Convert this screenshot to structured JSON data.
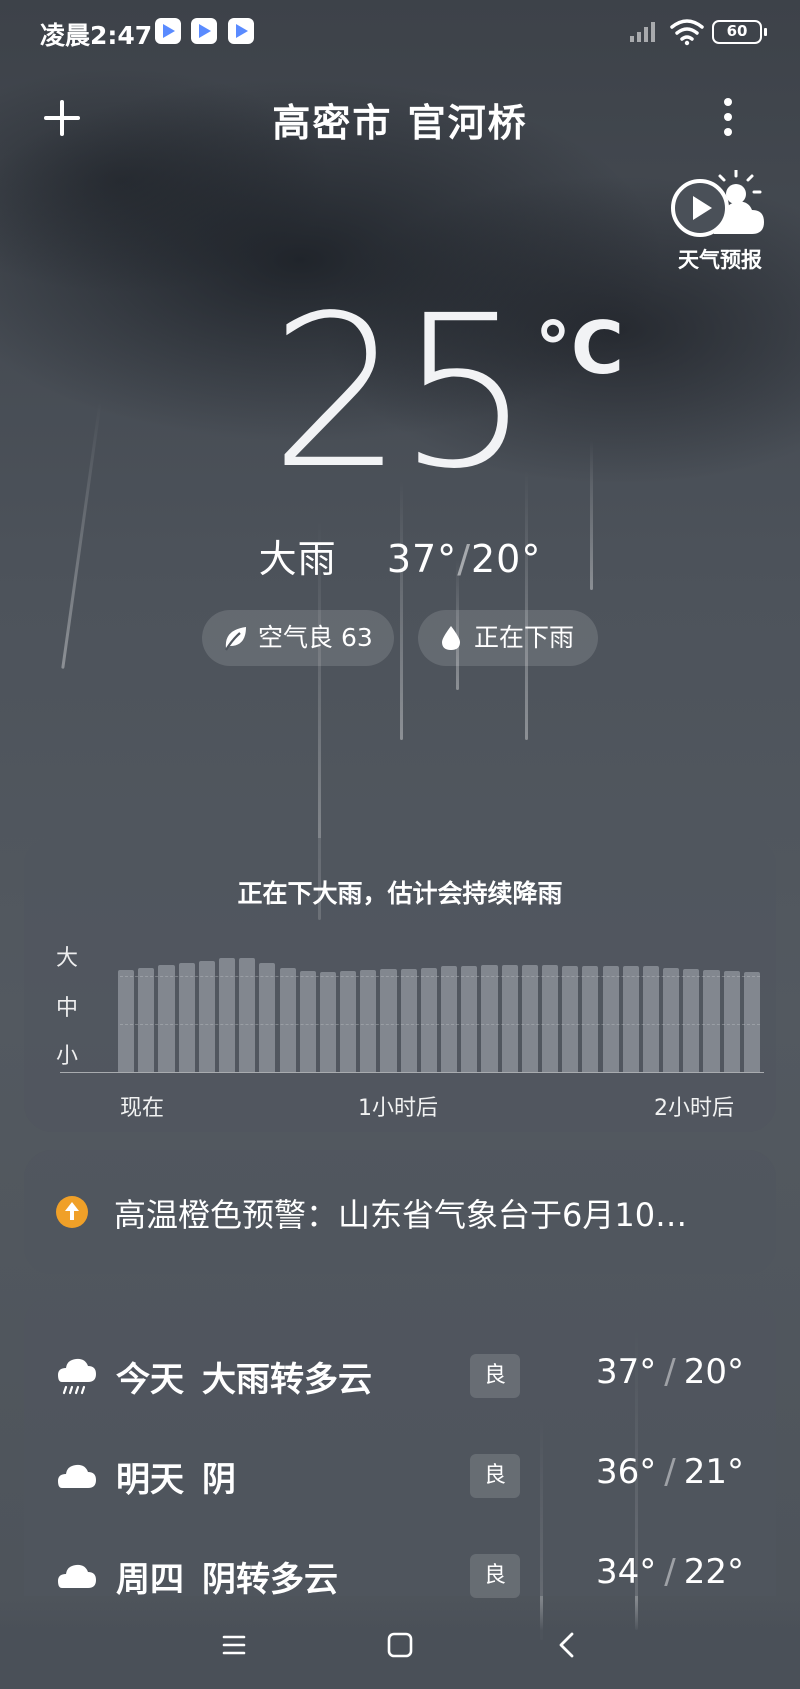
{
  "status_bar": {
    "time": "凌晨2:47",
    "battery": "60",
    "icons": [
      "app-store-icon",
      "app-store-icon",
      "app-store-icon",
      "signal-icon",
      "wifi-icon",
      "battery-icon"
    ]
  },
  "header": {
    "city": "高密市 官河桥",
    "add_icon": "plus-icon",
    "more_icon": "more-vertical-icon"
  },
  "forecast_video": {
    "label": "天气预报",
    "icon": "play-cloud-icon"
  },
  "current": {
    "temperature": "25",
    "unit": "°C",
    "condition": "大雨",
    "high": "37°",
    "low": "20°"
  },
  "chips": [
    {
      "label": "空气良 63",
      "icon": "leaf-icon"
    },
    {
      "label": "正在下雨",
      "icon": "raindrop-icon"
    }
  ],
  "precipitation": {
    "title": "正在下大雨，估计会持续降雨",
    "levels": [
      "大",
      "中",
      "小"
    ],
    "x_labels": [
      "现在",
      "1小时后",
      "2小时后"
    ],
    "intensity": [
      0.88,
      0.9,
      0.92,
      0.94,
      0.96,
      0.98,
      0.98,
      0.94,
      0.9,
      0.87,
      0.86,
      0.87,
      0.88,
      0.89,
      0.89,
      0.9,
      0.91,
      0.91,
      0.92,
      0.92,
      0.92,
      0.92,
      0.91,
      0.91,
      0.91,
      0.91,
      0.91,
      0.9,
      0.89,
      0.88,
      0.87,
      0.86
    ]
  },
  "warning": {
    "text": "高温橙色预警：山东省气象台于6月10…",
    "color": "#f0a028"
  },
  "daily": [
    {
      "day": "今天",
      "condition": "大雨转多云",
      "aqi": "良",
      "high": "37°",
      "low": "20°",
      "icon": "heavy-rain-icon"
    },
    {
      "day": "明天",
      "condition": "阴",
      "aqi": "良",
      "high": "36°",
      "low": "21°",
      "icon": "cloud-icon"
    },
    {
      "day": "周四",
      "condition": "阴转多云",
      "aqi": "良",
      "high": "34°",
      "low": "22°",
      "icon": "cloud-icon"
    }
  ],
  "temp_separator": "/",
  "nav": {
    "menu_icon": "menu-icon",
    "home_icon": "home-icon",
    "back_icon": "back-icon"
  }
}
